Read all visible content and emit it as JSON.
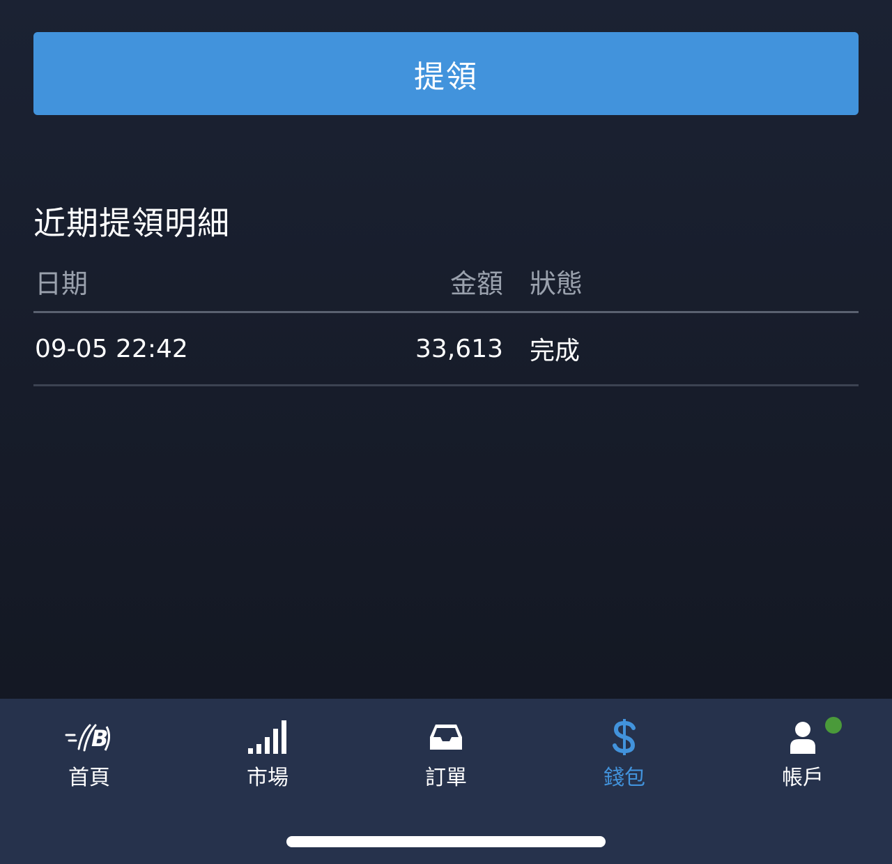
{
  "withdraw_button": {
    "label": "提領"
  },
  "recent": {
    "title": "近期提領明細",
    "columns": {
      "date": "日期",
      "amount": "金額",
      "status": "狀態"
    },
    "rows": [
      {
        "date": "09-05 22:42",
        "amount": "33,613",
        "status": "完成"
      }
    ]
  },
  "tabbar": {
    "tabs": [
      {
        "label": "首頁",
        "icon": "brand-logo-icon"
      },
      {
        "label": "市場",
        "icon": "signal-bars-icon"
      },
      {
        "label": "訂單",
        "icon": "inbox-tray-icon"
      },
      {
        "label": "錢包",
        "icon": "dollar-sign-icon",
        "active": true
      },
      {
        "label": "帳戶",
        "icon": "user-icon",
        "has_notification": true
      }
    ]
  },
  "colors": {
    "accent": "#4293dc",
    "tabbar_bg": "#26324c",
    "notification": "#4a9a3a"
  }
}
